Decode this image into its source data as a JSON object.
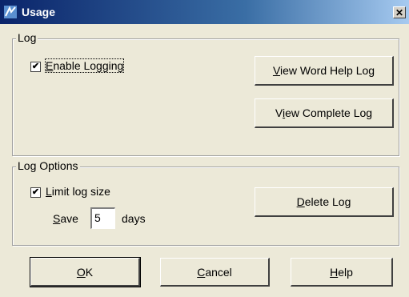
{
  "window": {
    "title": "Usage",
    "close_glyph": "✕",
    "icon": "usage-app-icon"
  },
  "log_group": {
    "legend": "Log",
    "enable_logging": {
      "label_rest": "nable Logging",
      "mnemonic": "E",
      "checked": true
    },
    "view_word_help_log": {
      "mnemonic": "V",
      "rest": "iew Word Help Log"
    },
    "view_complete_log": {
      "pre": "V",
      "mnemonic": "i",
      "rest": "ew Complete Log"
    }
  },
  "log_options_group": {
    "legend": "Log Options",
    "limit_log_size": {
      "mnemonic": "L",
      "rest": "imit log size",
      "checked": true
    },
    "save_label": {
      "mnemonic": "S",
      "rest": "ave"
    },
    "save_days_value": "5",
    "days_label": "days",
    "delete_log": {
      "mnemonic": "D",
      "rest": "elete Log"
    }
  },
  "buttons": {
    "ok": {
      "mnemonic": "O",
      "rest": "K"
    },
    "cancel": {
      "mnemonic": "C",
      "rest": "ancel"
    },
    "help": {
      "mnemonic": "H",
      "rest": "elp"
    }
  },
  "checkmark_glyph": "✔"
}
